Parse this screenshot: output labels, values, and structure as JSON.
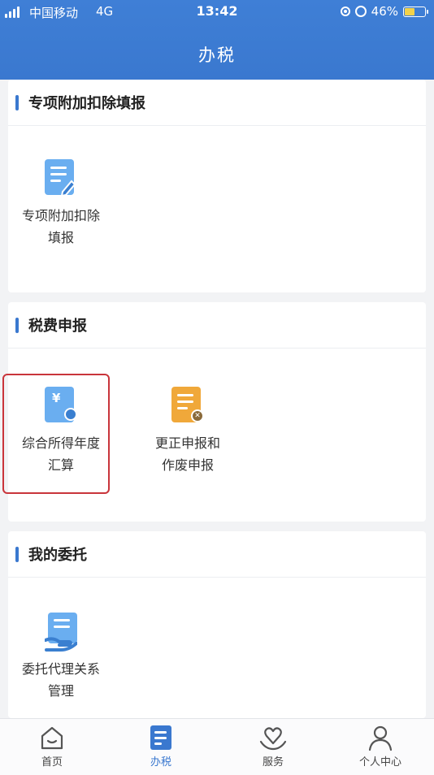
{
  "status_bar": {
    "carrier": "中国移动",
    "network": "4G",
    "time": "13:42",
    "battery": "46%"
  },
  "header": {
    "title": "办税"
  },
  "sections": [
    {
      "title": "专项附加扣除填报",
      "items": [
        {
          "line1": "专项附加扣除",
          "line2": "填报",
          "icon": "form-edit-icon"
        }
      ]
    },
    {
      "title": "税费申报",
      "items": [
        {
          "line1": "综合所得年度",
          "line2": "汇算",
          "icon": "yuan-document-icon"
        },
        {
          "line1": "更正申报和",
          "line2": "作废申报",
          "icon": "void-document-icon"
        }
      ]
    },
    {
      "title": "我的委托",
      "items": [
        {
          "line1": "委托代理关系",
          "line2": "管理",
          "icon": "entrust-hand-icon"
        }
      ]
    }
  ],
  "tabs": [
    {
      "label": "首页",
      "icon": "home-icon"
    },
    {
      "label": "办税",
      "icon": "tax-document-icon",
      "active": true
    },
    {
      "label": "服务",
      "icon": "heart-hand-icon"
    },
    {
      "label": "个人中心",
      "icon": "person-icon"
    }
  ],
  "colors": {
    "primary": "#3a78cf",
    "selection": "#c9353b",
    "accent_orange": "#f0a83a"
  }
}
